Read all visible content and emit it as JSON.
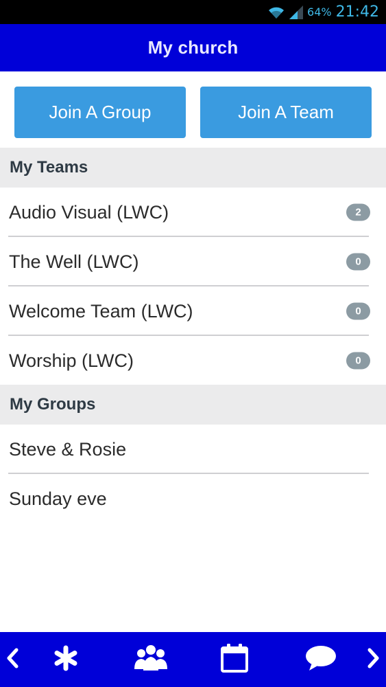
{
  "status_bar": {
    "battery": "64%",
    "time": "21:42",
    "icons": [
      "wifi-icon",
      "signal-icon"
    ]
  },
  "header": {
    "title": "My church"
  },
  "actions": {
    "join_group_label": "Join A Group",
    "join_team_label": "Join A Team"
  },
  "teams": {
    "heading": "My Teams",
    "items": [
      {
        "name": "Audio Visual (LWC)",
        "count": "2"
      },
      {
        "name": "The Well (LWC)",
        "count": "0"
      },
      {
        "name": "Welcome Team (LWC)",
        "count": "0"
      },
      {
        "name": "Worship (LWC)",
        "count": "0"
      }
    ]
  },
  "groups": {
    "heading": "My Groups",
    "items": [
      {
        "name": "Steve & Rosie"
      },
      {
        "name": "Sunday eve"
      }
    ]
  },
  "bottom_nav": {
    "items": [
      "back-icon",
      "asterisk-icon",
      "people-icon",
      "calendar-icon",
      "chat-icon",
      "forward-icon"
    ]
  },
  "colors": {
    "header_bg": "#0000d8",
    "button_bg": "#3a9be0",
    "section_bg": "#ebebec",
    "badge_bg": "#8c9ba3",
    "status_text": "#3fb8e6"
  }
}
